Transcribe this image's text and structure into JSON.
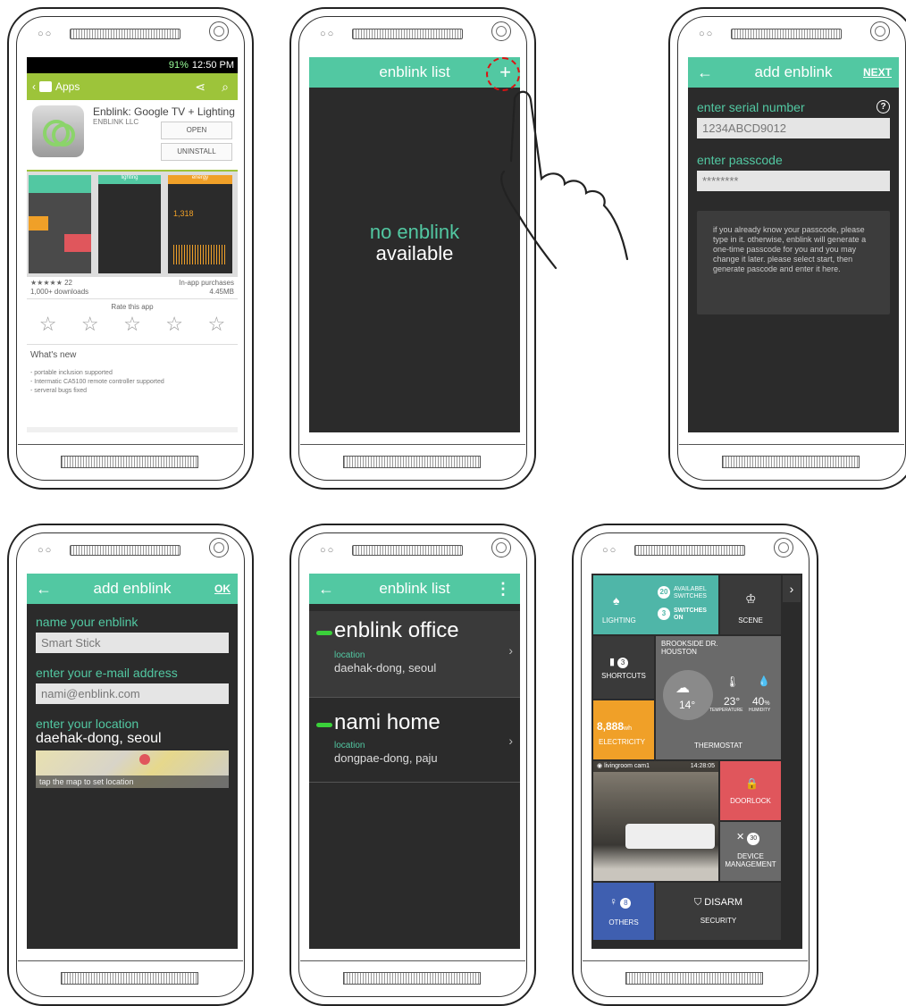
{
  "colors": {
    "accent": "#52c8a2",
    "dark": "#2b2b2b",
    "playGreen": "#9dc43a",
    "red": "#e0565c",
    "blue": "#3f5fb0",
    "orange": "#f0a028"
  },
  "phone1": {
    "status_time": "12:50 PM",
    "status_battery": "91%",
    "actionbar_title": "Apps",
    "app_name": "Enblink: Google TV + Lighting",
    "developer": "ENBLINK LLC",
    "open_label": "OPEN",
    "uninstall_label": "UNINSTALL",
    "thumb_titles": [
      "lighting",
      "energy"
    ],
    "rating_count": "22",
    "downloads": "1,000+ downloads",
    "inapp": "In-app purchases",
    "size": "4.45MB",
    "rate_title": "Rate this app",
    "whats_new": "What's new",
    "notes": [
      "- portable inclusion supported",
      "- Intermatic CA5100 remote controller supported",
      "- serveral bugs fixed"
    ]
  },
  "phone2": {
    "title": "enblink list",
    "add_symbol": "+",
    "empty_line1": "no enblink",
    "empty_line2": "available"
  },
  "phone3": {
    "title": "add enblink",
    "back": "←",
    "next": "NEXT",
    "serial_label": "enter serial number",
    "serial_value": "1234ABCD9012",
    "pass_label": "enter passcode",
    "pass_value": "********",
    "help": "?",
    "info": "if you already know your passcode, please type in it. otherwise, enblink will generate a one-time passcode for you and you may change it later. please select start, then generate pascode and enter it here."
  },
  "phone4": {
    "title": "add enblink",
    "back": "←",
    "ok": "OK",
    "name_label": "name your enblink",
    "name_value": "Smart Stick",
    "email_label": "enter your e-mail address",
    "email_value": "nami@enblink.com",
    "loc_label": "enter your location",
    "loc_value": "daehak-dong, seoul",
    "map_caption": "tap the map to set location"
  },
  "phone5": {
    "title": "enblink list",
    "back": "←",
    "menu": "⋮",
    "items": [
      {
        "name": "enblink office",
        "loc_label": "location",
        "loc": "daehak-dong, seoul"
      },
      {
        "name": "nami home",
        "loc_label": "location",
        "loc": "dongpae-dong, paju"
      }
    ]
  },
  "phone6": {
    "lighting": "LIGHTING",
    "avail_count": "20",
    "avail_label": "AVAILABEL SWITCHES",
    "on_count": "3",
    "on_label": "SWITCHES ON",
    "scene": "SCENE",
    "shortcuts": "SHORTCUTS",
    "shortcuts_count": "3",
    "address": "BROOKSIDE DR. HOUSTON",
    "weather_temp": "14°",
    "temp": "23°",
    "temp_label": "TEMPERATURE",
    "humidity": "40",
    "humidity_unit": "%",
    "humidity_label": "HUMIDITY",
    "thermostat": "THERMOSTAT",
    "electricity_value": "8,888",
    "electricity_unit": "wh",
    "electricity": "ELECTRICITY",
    "cam_name": "livingroom cam1",
    "cam_time": "14:28:05",
    "doorlock": "DOORLOCK",
    "device_count": "30",
    "device_mgmt": "DEVICE MANAGEMENT",
    "others_count": "8",
    "others": "OTHERS",
    "disarm": "DISARM",
    "security": "SECURITY"
  }
}
